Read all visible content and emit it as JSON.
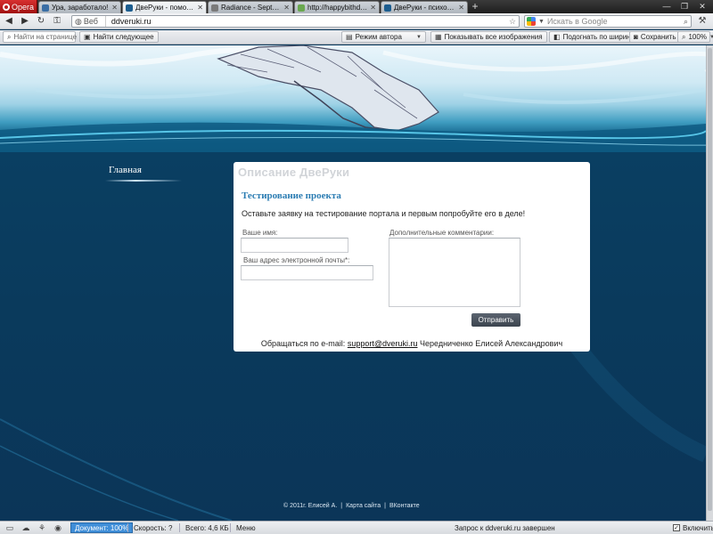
{
  "browser": {
    "menu_label": "Opera",
    "tabs": [
      {
        "title": "Ура, заработало!",
        "active": false,
        "favicon_color": "#3a6ea5"
      },
      {
        "title": "ДвеРуки - помощь до...",
        "active": true,
        "favicon_color": "#1c5d8f"
      },
      {
        "title": "Radiance - September ...",
        "active": false,
        "favicon_color": "#7a7a7a"
      },
      {
        "title": "http://happybithday/",
        "active": false,
        "favicon_color": "#6aa84f"
      },
      {
        "title": "ДвеРуки - психолог-к...",
        "active": false,
        "favicon_color": "#1c5d8f"
      }
    ],
    "new_tab_symbol": "+",
    "address": {
      "badge": "Веб",
      "url": "ddveruki.ru"
    },
    "search": {
      "placeholder": "Искать в Google"
    },
    "toolbar": {
      "find_placeholder": "Найти на странице",
      "find_next": "Найти следующее",
      "author_mode": "Режим автора",
      "show_images": "Показывать все изображения",
      "fit_width": "Подогнать по ширине",
      "save": "Сохранить",
      "zoom": "100%"
    },
    "status": {
      "document": "Документ:  100%",
      "speed": "Скорость:  ?",
      "total": "Всего:  4,6 КБ",
      "menu": "Меню",
      "message": "Запрос к ddveruki.ru завершен",
      "enable": "Включить"
    }
  },
  "site": {
    "nav": {
      "home": "Главная"
    },
    "panel": {
      "title": "Описание ДвеРуки",
      "heading": "Тестирование проекта",
      "intro": "Оставьте заявку на тестирование портала и первым попробуйте его в деле!",
      "name_label": "Ваше имя:",
      "email_label": "Ваш адрес электронной почты*:",
      "comments_label": "Дополнительные комментарии:",
      "submit": "Отправить",
      "contact_prefix": "Обращаться по e-mail:",
      "contact_email": "support@dveruki.ru",
      "contact_name": "Чередниченко Елисей Александрович"
    },
    "footer": {
      "copyright": "© 2011г. Елисей А.",
      "sitemap": "Карта сайта",
      "vk": "ВКонтакте"
    }
  },
  "colors": {
    "page_bg": "#0a3a5e",
    "heading_blue": "#2c7db3",
    "button_dark": "#4a525c",
    "status_doc_blue": "#3f8ed8"
  }
}
